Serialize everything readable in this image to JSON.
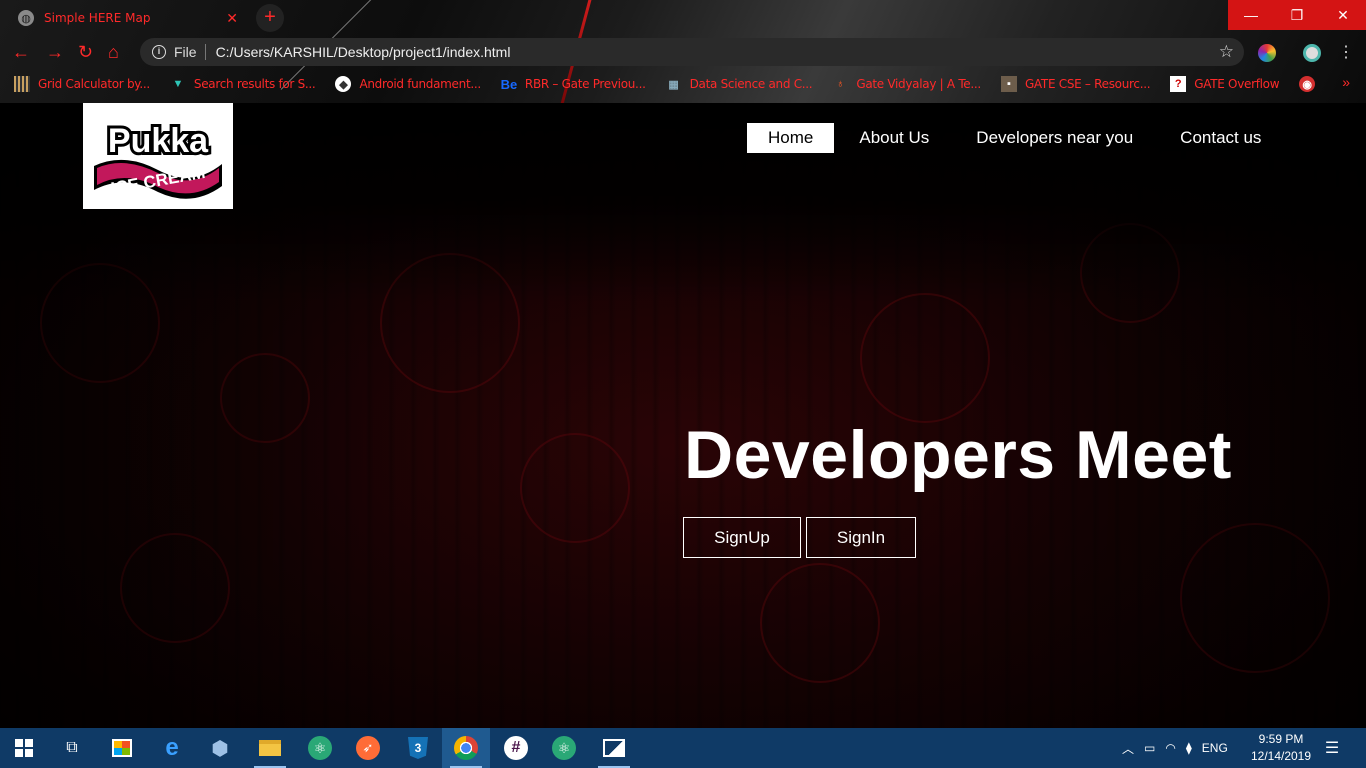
{
  "browser": {
    "tab_title": "Simple HERE Map",
    "new_tab_symbol": "+",
    "address_scheme": "File",
    "address_url": "C:/Users/KARSHIL/Desktop/project1/index.html",
    "bookmarks": [
      {
        "label": "Grid Calculator by...",
        "icon": "grid-icon"
      },
      {
        "label": "Search results for S...",
        "icon": "search-results-icon"
      },
      {
        "label": "Android fundament...",
        "icon": "android-icon"
      },
      {
        "label": "RBR – Gate Previou...",
        "icon": "behance-icon",
        "icon_text": "Be"
      },
      {
        "label": "Data Science and C...",
        "icon": "data-science-icon"
      },
      {
        "label": "Gate Vidyalay | A Te...",
        "icon": "gate-vidyalay-icon"
      },
      {
        "label": "GATE CSE – Resourc...",
        "icon": "gate-cse-icon"
      },
      {
        "label": "GATE Overflow",
        "icon": "gate-overflow-icon"
      }
    ],
    "accent_color": "#ff2a2a"
  },
  "site": {
    "logo": {
      "line1": "Pukka",
      "line2": "ICE CREAM"
    },
    "nav": [
      {
        "label": "Home",
        "active": true
      },
      {
        "label": "About Us",
        "active": false
      },
      {
        "label": "Developers near you",
        "active": false
      },
      {
        "label": "Contact us",
        "active": false
      }
    ],
    "hero_title": "Developers Meet",
    "signup_label": "SignUp",
    "signin_label": "SignIn"
  },
  "taskbar": {
    "apps": [
      "start-icon",
      "task-view-icon",
      "store-icon",
      "edge-icon",
      "virtualbox-icon",
      "file-explorer-icon",
      "atom-icon",
      "postman-icon",
      "css3-icon",
      "chrome-icon",
      "slack-icon",
      "atom-icon-2",
      "photos-icon"
    ],
    "language": "ENG",
    "time": "9:59 PM",
    "date": "12/14/2019"
  }
}
